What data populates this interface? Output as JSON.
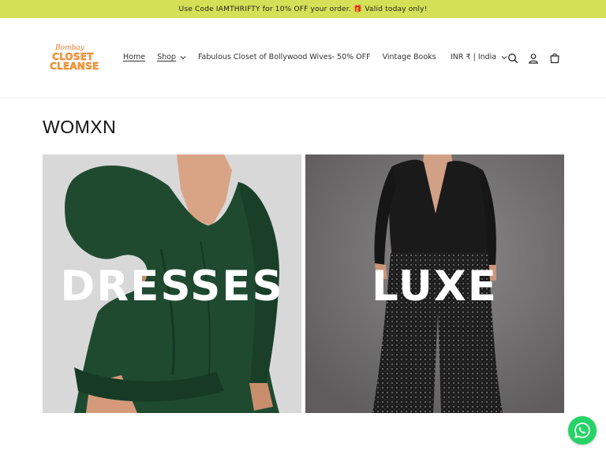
{
  "announcement": "Use Code IAMTHRIFTY for 10% OFF your order. 🎁 Valid today only!",
  "logo": {
    "script": "Bombay",
    "line1": "CLOSET",
    "line2": "CLEANSE"
  },
  "nav": {
    "items": [
      {
        "label": "Home",
        "active": true
      },
      {
        "label": "Shop",
        "has_dropdown": true
      },
      {
        "label": "Fabulous Closet of Bollywood Wives- 50% OFF"
      },
      {
        "label": "Vintage Books"
      }
    ]
  },
  "locale": "INR ₹ | India",
  "header_icons": [
    "search-icon",
    "account-icon",
    "cart-icon"
  ],
  "section": {
    "title": "WOMXN"
  },
  "collections": [
    {
      "label": "DRESSES"
    },
    {
      "label": "LUXE"
    }
  ],
  "colors": {
    "announcement_bg": "#d4e157",
    "whatsapp": "#25d366",
    "dress_green": "#1f4a30"
  }
}
